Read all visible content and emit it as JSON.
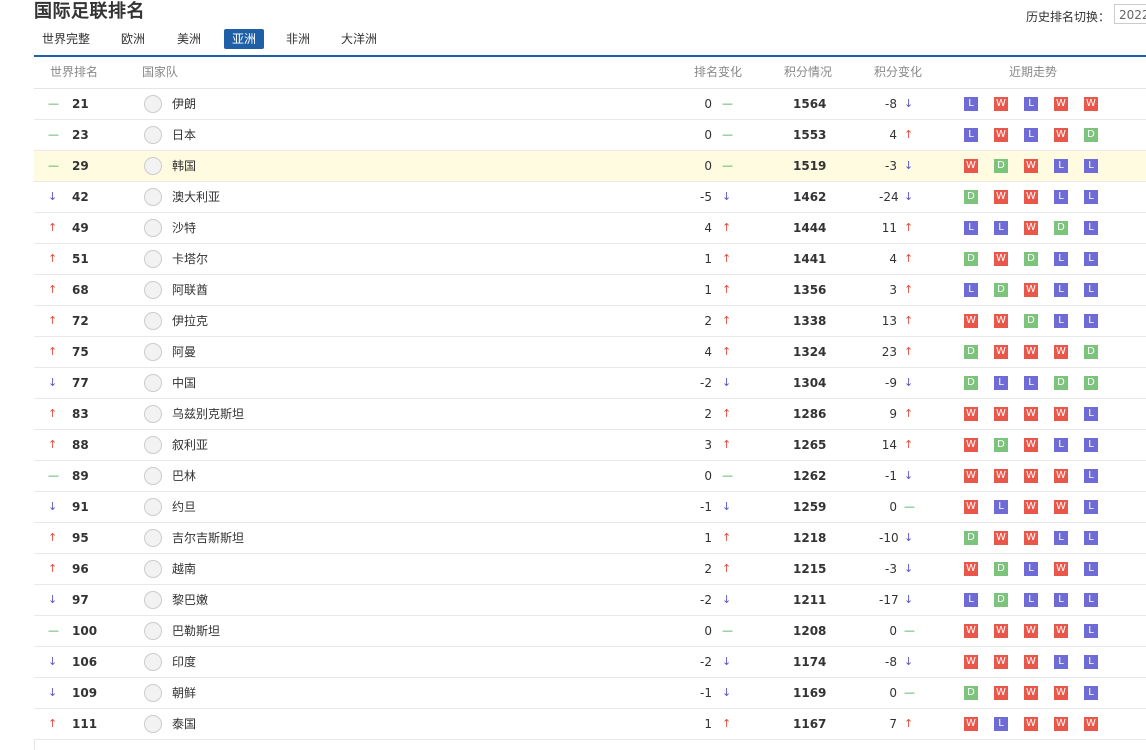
{
  "page_title": "国际足联排名",
  "history": {
    "label": "历史排名切换：",
    "selected": "2022"
  },
  "tabs": [
    {
      "label": "世界完整",
      "active": false
    },
    {
      "label": "欧洲",
      "active": false
    },
    {
      "label": "美洲",
      "active": false
    },
    {
      "label": "亚洲",
      "active": true
    },
    {
      "label": "非洲",
      "active": false
    },
    {
      "label": "大洋洲",
      "active": false
    }
  ],
  "columns": {
    "rank": "世界排名",
    "team": "国家队",
    "rank_change": "排名变化",
    "points": "积分情况",
    "points_change": "积分变化",
    "form": "近期走势"
  },
  "colors": {
    "accent": "#1f5fa7",
    "win": "#e8574a",
    "loss": "#6e6bd6",
    "draw": "#7cc37c",
    "up": "#e24b3f",
    "down": "#5b56c8",
    "same": "#3ba54b"
  },
  "rows": [
    {
      "trend": "same",
      "rank": "21",
      "team": "伊朗",
      "rank_change": "0",
      "rank_trend": "same",
      "points": "1564",
      "points_change": "-8",
      "points_trend": "down",
      "form": [
        "L",
        "W",
        "L",
        "W",
        "W"
      ],
      "highlight": false
    },
    {
      "trend": "same",
      "rank": "23",
      "team": "日本",
      "rank_change": "0",
      "rank_trend": "same",
      "points": "1553",
      "points_change": "4",
      "points_trend": "up",
      "form": [
        "L",
        "W",
        "L",
        "W",
        "D"
      ],
      "highlight": false
    },
    {
      "trend": "same",
      "rank": "29",
      "team": "韩国",
      "rank_change": "0",
      "rank_trend": "same",
      "points": "1519",
      "points_change": "-3",
      "points_trend": "down",
      "form": [
        "W",
        "D",
        "W",
        "L",
        "L"
      ],
      "highlight": true
    },
    {
      "trend": "down",
      "rank": "42",
      "team": "澳大利亚",
      "rank_change": "-5",
      "rank_trend": "down",
      "points": "1462",
      "points_change": "-24",
      "points_trend": "down",
      "form": [
        "D",
        "W",
        "W",
        "L",
        "L"
      ],
      "highlight": false
    },
    {
      "trend": "up",
      "rank": "49",
      "team": "沙特",
      "rank_change": "4",
      "rank_trend": "up",
      "points": "1444",
      "points_change": "11",
      "points_trend": "up",
      "form": [
        "L",
        "L",
        "W",
        "D",
        "L"
      ],
      "highlight": false
    },
    {
      "trend": "up",
      "rank": "51",
      "team": "卡塔尔",
      "rank_change": "1",
      "rank_trend": "up",
      "points": "1441",
      "points_change": "4",
      "points_trend": "up",
      "form": [
        "D",
        "W",
        "D",
        "L",
        "L"
      ],
      "highlight": false
    },
    {
      "trend": "up",
      "rank": "68",
      "team": "阿联酋",
      "rank_change": "1",
      "rank_trend": "up",
      "points": "1356",
      "points_change": "3",
      "points_trend": "up",
      "form": [
        "L",
        "D",
        "W",
        "L",
        "L"
      ],
      "highlight": false
    },
    {
      "trend": "up",
      "rank": "72",
      "team": "伊拉克",
      "rank_change": "2",
      "rank_trend": "up",
      "points": "1338",
      "points_change": "13",
      "points_trend": "up",
      "form": [
        "W",
        "W",
        "D",
        "L",
        "L"
      ],
      "highlight": false
    },
    {
      "trend": "up",
      "rank": "75",
      "team": "阿曼",
      "rank_change": "4",
      "rank_trend": "up",
      "points": "1324",
      "points_change": "23",
      "points_trend": "up",
      "form": [
        "D",
        "W",
        "W",
        "W",
        "D"
      ],
      "highlight": false
    },
    {
      "trend": "down",
      "rank": "77",
      "team": "中国",
      "rank_change": "-2",
      "rank_trend": "down",
      "points": "1304",
      "points_change": "-9",
      "points_trend": "down",
      "form": [
        "D",
        "L",
        "L",
        "D",
        "D"
      ],
      "highlight": false
    },
    {
      "trend": "up",
      "rank": "83",
      "team": "乌兹别克斯坦",
      "rank_change": "2",
      "rank_trend": "up",
      "points": "1286",
      "points_change": "9",
      "points_trend": "up",
      "form": [
        "W",
        "W",
        "W",
        "W",
        "L"
      ],
      "highlight": false
    },
    {
      "trend": "up",
      "rank": "88",
      "team": "叙利亚",
      "rank_change": "3",
      "rank_trend": "up",
      "points": "1265",
      "points_change": "14",
      "points_trend": "up",
      "form": [
        "W",
        "D",
        "W",
        "L",
        "L"
      ],
      "highlight": false
    },
    {
      "trend": "same",
      "rank": "89",
      "team": "巴林",
      "rank_change": "0",
      "rank_trend": "same",
      "points": "1262",
      "points_change": "-1",
      "points_trend": "down",
      "form": [
        "W",
        "W",
        "W",
        "W",
        "L"
      ],
      "highlight": false
    },
    {
      "trend": "down",
      "rank": "91",
      "team": "约旦",
      "rank_change": "-1",
      "rank_trend": "down",
      "points": "1259",
      "points_change": "0",
      "points_trend": "same",
      "form": [
        "W",
        "L",
        "W",
        "W",
        "L"
      ],
      "highlight": false
    },
    {
      "trend": "up",
      "rank": "95",
      "team": "吉尔吉斯斯坦",
      "rank_change": "1",
      "rank_trend": "up",
      "points": "1218",
      "points_change": "-10",
      "points_trend": "down",
      "form": [
        "D",
        "W",
        "W",
        "L",
        "L"
      ],
      "highlight": false
    },
    {
      "trend": "up",
      "rank": "96",
      "team": "越南",
      "rank_change": "2",
      "rank_trend": "up",
      "points": "1215",
      "points_change": "-3",
      "points_trend": "down",
      "form": [
        "W",
        "D",
        "L",
        "W",
        "L"
      ],
      "highlight": false
    },
    {
      "trend": "down",
      "rank": "97",
      "team": "黎巴嫩",
      "rank_change": "-2",
      "rank_trend": "down",
      "points": "1211",
      "points_change": "-17",
      "points_trend": "down",
      "form": [
        "L",
        "D",
        "L",
        "L",
        "L"
      ],
      "highlight": false
    },
    {
      "trend": "same",
      "rank": "100",
      "team": "巴勒斯坦",
      "rank_change": "0",
      "rank_trend": "same",
      "points": "1208",
      "points_change": "0",
      "points_trend": "same",
      "form": [
        "W",
        "W",
        "W",
        "W",
        "L"
      ],
      "highlight": false
    },
    {
      "trend": "down",
      "rank": "106",
      "team": "印度",
      "rank_change": "-2",
      "rank_trend": "down",
      "points": "1174",
      "points_change": "-8",
      "points_trend": "down",
      "form": [
        "W",
        "W",
        "W",
        "L",
        "L"
      ],
      "highlight": false
    },
    {
      "trend": "down",
      "rank": "109",
      "team": "朝鲜",
      "rank_change": "-1",
      "rank_trend": "down",
      "points": "1169",
      "points_change": "0",
      "points_trend": "same",
      "form": [
        "D",
        "W",
        "W",
        "W",
        "L"
      ],
      "highlight": false
    },
    {
      "trend": "up",
      "rank": "111",
      "team": "泰国",
      "rank_change": "1",
      "rank_trend": "up",
      "points": "1167",
      "points_change": "7",
      "points_trend": "up",
      "form": [
        "W",
        "L",
        "W",
        "W",
        "W"
      ],
      "highlight": false
    }
  ]
}
